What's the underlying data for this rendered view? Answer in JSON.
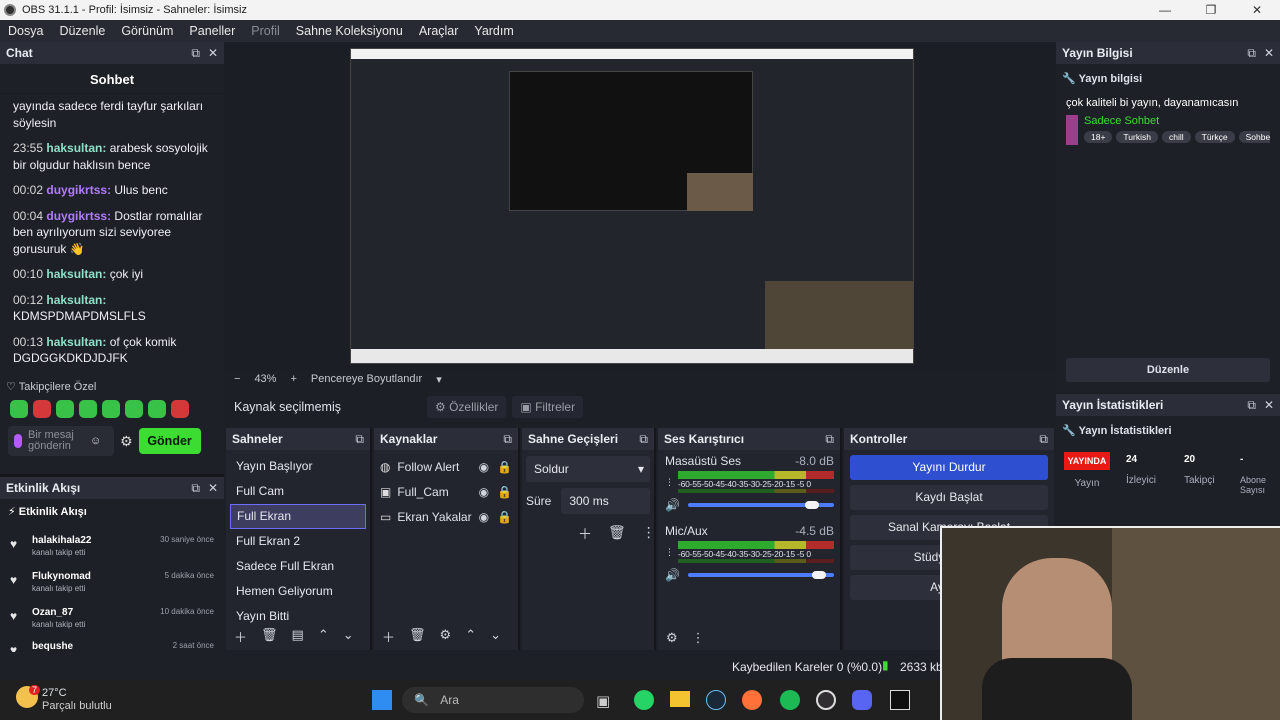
{
  "titlebar": {
    "title": "OBS 31.1.1 - Profil: İsimsiz - Sahneler: İsimsiz"
  },
  "menu": [
    "Dosya",
    "Düzenle",
    "Görünüm",
    "Paneller",
    "Profil",
    "Sahne Koleksiyonu",
    "Araçlar",
    "Yardım"
  ],
  "chat": {
    "dock_title": "Chat",
    "title": "Sohbet",
    "messages": [
      {
        "time": "",
        "user": "",
        "text": "yayında sadece ferdi tayfur şarkıları söylesin"
      },
      {
        "time": "23:55",
        "user": "haksultan",
        "text": "arabesk sosyolojik bir olgudur haklısın bence"
      },
      {
        "time": "00:02",
        "user": "duygikrtss",
        "text": "Ulus benc"
      },
      {
        "time": "00:04",
        "user": "duygikrtss",
        "text": "Dostlar romalılar ben ayrılıyorum sizi seviyoree gorusuruk"
      },
      {
        "time": "00:10",
        "user": "haksultan",
        "text": "çok iyi"
      },
      {
        "time": "00:12",
        "user": "haksultan",
        "text": "KDMSPDMAPDMSLFLS"
      },
      {
        "time": "00:13",
        "user": "haksultan",
        "text": "of çok komik DGDGGKDKDJDJFK"
      }
    ],
    "followers_label": "Takipçilere Özel",
    "input_placeholder": "Bir mesaj gönderin",
    "send_label": "Gönder"
  },
  "activity": {
    "dock_title": "Etkinlik Akışı",
    "sub_title": "Etkinlik Akışı",
    "items": [
      {
        "name": "halakihala22",
        "desc": "kanalı takip etti",
        "when": "30 saniye önce"
      },
      {
        "name": "Flukynomad",
        "desc": "kanalı takip etti",
        "when": "5 dakika önce"
      },
      {
        "name": "Ozan_87",
        "desc": "kanalı takip etti",
        "when": "10 dakika önce"
      },
      {
        "name": "bequshe",
        "desc": "",
        "when": "2 saat önce"
      }
    ]
  },
  "preview": {
    "zoom": "43%",
    "fit_label": "Pencereye Boyutlandır"
  },
  "source_bar": {
    "none_label": "Kaynak seçilmemiş",
    "properties": "Özellikler",
    "filters": "Filtreler"
  },
  "scenes": {
    "title": "Sahneler",
    "items": [
      "Yayın Başlıyor",
      "Full Cam",
      "Full Ekran",
      "Full Ekran 2",
      "Sadece Full Ekran",
      "Hemen Geliyorum",
      "Yayın Bitti"
    ],
    "selected_index": 2
  },
  "sources": {
    "title": "Kaynaklar",
    "items": [
      {
        "name": "Follow Alert",
        "icon": "globe-icon"
      },
      {
        "name": "Full_Cam",
        "icon": "camera-icon"
      },
      {
        "name": "Ekran Yakalar",
        "icon": "monitor-icon"
      }
    ]
  },
  "transitions": {
    "title": "Sahne Geçişleri",
    "type": "Soldur",
    "duration_label": "Süre",
    "duration": "300 ms"
  },
  "mixer": {
    "title": "Ses Karıştırıcı",
    "channels": [
      {
        "name": "Masaüstü Ses",
        "db": "-8.0 dB",
        "volume": 0.8
      },
      {
        "name": "Mic/Aux",
        "db": "-4.5 dB",
        "volume": 0.85
      }
    ],
    "scale": "-60-55-50-45-40-35-30-25-20-15 -5 0"
  },
  "controls": {
    "title": "Kontroller",
    "buttons": [
      "Yayını Durdur",
      "Kaydı Başlat",
      "Sanal Kamerayı Başlat",
      "Stüdyo Modu",
      "Ayarlar"
    ]
  },
  "stream_info": {
    "dock_title": "Yayın Bilgisi",
    "sub_title": "Yayın bilgisi",
    "stream_title": "çok kaliteli bi yayın, dayanamıcasın",
    "category": "Sadece Sohbet",
    "tags": [
      "18+",
      "Turkish",
      "chill",
      "Türkçe",
      "Sohbet"
    ],
    "edit_label": "Düzenle"
  },
  "stream_stats": {
    "dock_title": "Yayın İstatistikleri",
    "sub_title": "Yayın İstatistikleri",
    "live_badge": "YAYINDA",
    "live_label": "Yayın",
    "viewers": "24",
    "viewers_label": "İzleyici",
    "followers": "20",
    "followers_label": "Takipçi",
    "subs": "-",
    "subs_label": "Abone Sayısı"
  },
  "status": {
    "dropped": "Kaybedilen Kareler 0 (%0.0)",
    "bitrate": "2633 kb"
  },
  "taskbar": {
    "temp": "27°C",
    "weather": "Parçalı bulutlu",
    "search_placeholder": "Ara",
    "weather_badge": "7"
  },
  "colors": {
    "accent": "#2e4fd0",
    "send": "#3cdc32",
    "live": "#e91916"
  }
}
